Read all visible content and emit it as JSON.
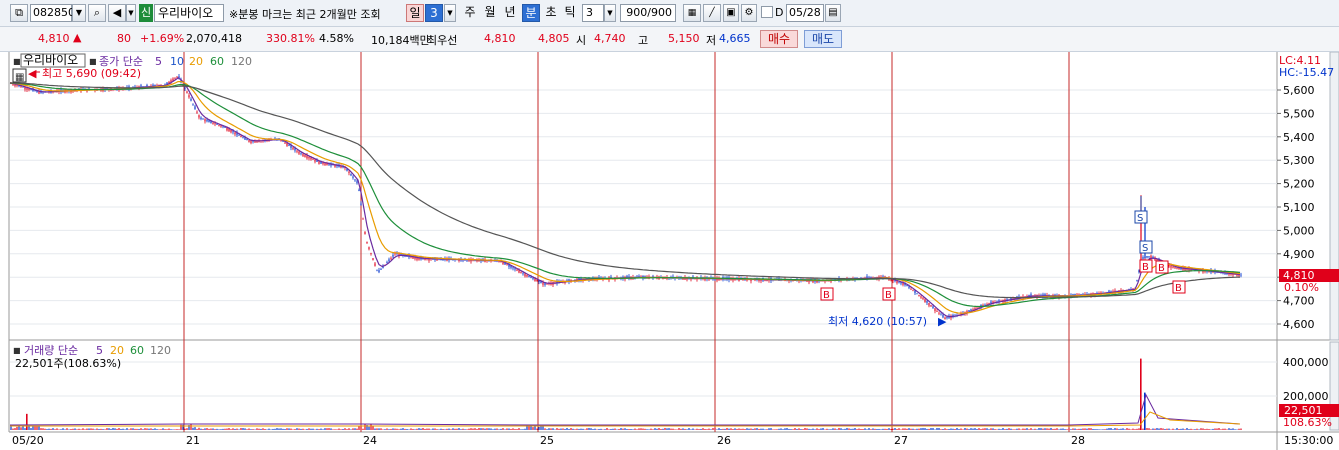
{
  "toolbar": {
    "stock_code": "082850",
    "market_badge": "신",
    "stock_name": "우리바이오",
    "notice": "※분봉 마크는 최근 2개월만 조회",
    "period_tabs": [
      "일",
      "3",
      "주",
      "월",
      "년",
      "분",
      "초",
      "틱"
    ],
    "interval_value": "3",
    "count_value": "900/900",
    "d_label": "D",
    "date_value": "05/28"
  },
  "quote": {
    "price": "4,810",
    "arrow": "▲",
    "change": "80",
    "change_pct": "+1.69%",
    "volume": "2,070,418",
    "vol_ratio": "330.81%",
    "turnover": "4.58%",
    "amount": "10,184백만",
    "best_label": "최우선",
    "ask": "4,810",
    "bid": "4,805",
    "open_label": "시",
    "open": "4,740",
    "high_label": "고",
    "high": "5,150",
    "low_label": "저",
    "low": "4,665",
    "buy_label": "매수",
    "sell_label": "매도"
  },
  "chart": {
    "legend_name": "우리바이오",
    "legend_ma": "종가 단순",
    "ma_periods": [
      "5",
      "10",
      "20",
      "60",
      "120"
    ],
    "max_note": "최고 5,690 (09:42)",
    "min_note": "최저 4,620 (10:57)",
    "lc_label": "LC:4.11",
    "hc_label": "HC:-15.47",
    "price_ticks": [
      "5,600",
      "5,500",
      "5,400",
      "5,300",
      "5,200",
      "5,100",
      "5,000",
      "4,900",
      "4,800",
      "4,700",
      "4,600"
    ],
    "last_price_tag": "4,810",
    "last_pct_tag": "0.10%",
    "dates": [
      "05/20",
      "21",
      "24",
      "25",
      "26",
      "27",
      "28"
    ],
    "time_label": "15:30:00",
    "volume_legend": "거래량 단순",
    "volume_ma": [
      "5",
      "20",
      "60",
      "120"
    ],
    "volume_info": "22,501주(108.63%)",
    "volume_ticks": [
      "400,000",
      "200,000"
    ],
    "volume_tag": "22,501",
    "volume_pct_tag": "108.63%",
    "marker_s": "S",
    "marker_b": "B",
    "colors": {
      "up": "#e0001a",
      "down": "#0033cc",
      "ma5": "#6a2aa0",
      "ma10": "#e89c00",
      "ma20": "#1e8f3a",
      "ma60": "#555555",
      "ma120": "#888888"
    }
  }
}
